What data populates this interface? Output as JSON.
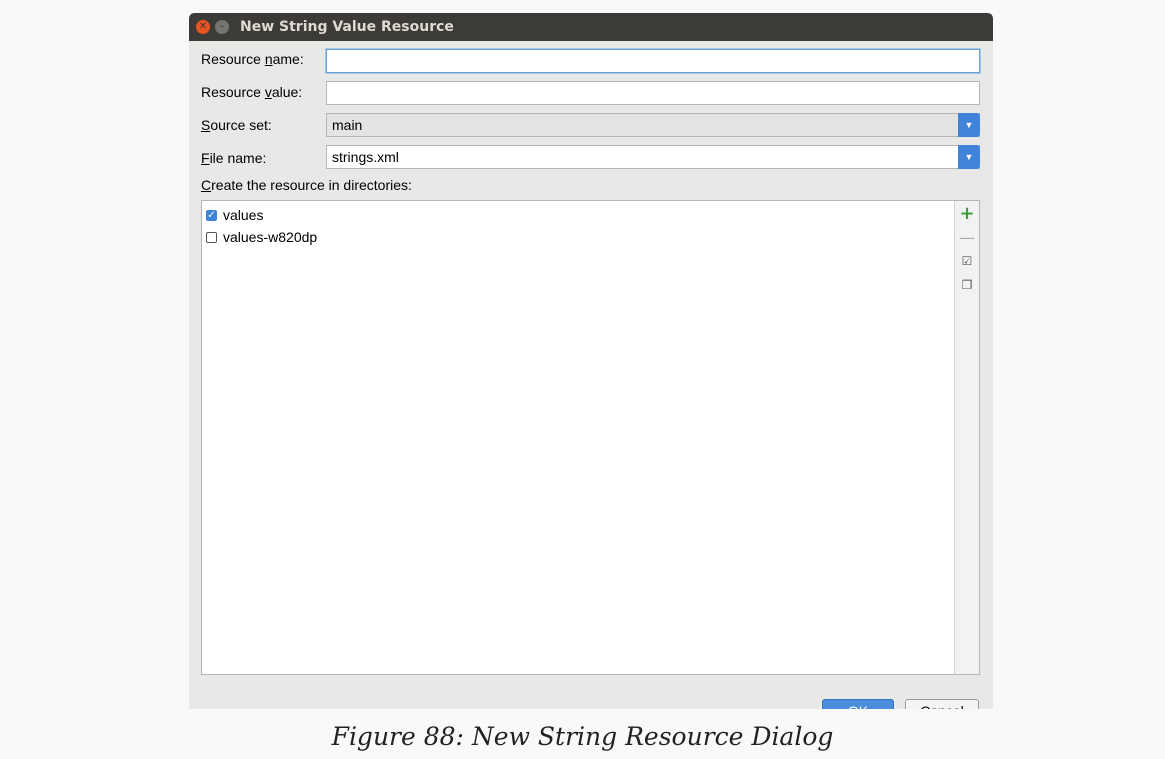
{
  "window": {
    "title": "New String Value Resource",
    "close_symbol": "✕",
    "minimize_symbol": "–"
  },
  "form": {
    "resource_name": {
      "label_pre": "Resource ",
      "label_mnemonic": "n",
      "label_post": "ame:",
      "value": ""
    },
    "resource_value": {
      "label_pre": "Resource ",
      "label_mnemonic": "v",
      "label_post": "alue:",
      "value": ""
    },
    "source_set": {
      "label_mnemonic": "S",
      "label_post": "ource set:",
      "value": "main"
    },
    "file_name": {
      "label_mnemonic": "F",
      "label_post": "ile name:",
      "value": "strings.xml"
    },
    "dropdown_arrow": "▼"
  },
  "directories": {
    "label_mnemonic": "C",
    "label_post": "reate the resource in directories:",
    "items": [
      {
        "label": "values",
        "checked": true,
        "check_mark": "✓"
      },
      {
        "label": "values-w820dp",
        "checked": false,
        "check_mark": ""
      }
    ],
    "tools": {
      "add": "+",
      "remove": "—",
      "select_all": "☑",
      "unselect_all": "❐"
    }
  },
  "buttons": {
    "ok": "OK",
    "cancel": "Cancel"
  },
  "caption": "Figure 88: New String Resource Dialog",
  "colors": {
    "accent": "#3f83db",
    "titlebar": "#3c3b37",
    "close": "#e95420",
    "add_green": "#39a039"
  }
}
